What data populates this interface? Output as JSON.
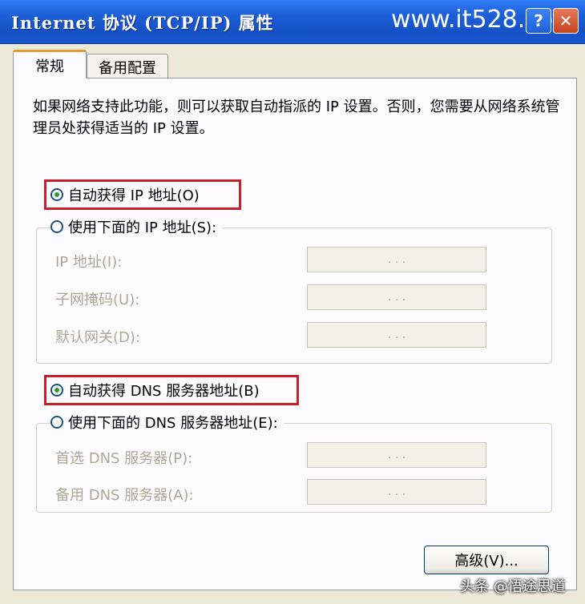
{
  "window": {
    "title": "Internet 协议 (TCP/IP) 属性",
    "watermark": "www.it528.com",
    "help_glyph": "?",
    "close_glyph": "✕"
  },
  "tabs": [
    {
      "label": "常规",
      "active": true
    },
    {
      "label": "备用配置",
      "active": false
    }
  ],
  "description": "如果网络支持此功能，则可以获取自动指派的 IP 设置。否则，您需要从网络系统管理员处获得适当的 IP 设置。",
  "ip_section": {
    "auto_radio": {
      "label": "自动获得 IP 地址(O)",
      "selected": true
    },
    "manual_radio": {
      "label": "使用下面的 IP 地址(S):",
      "selected": false
    },
    "fields": [
      {
        "label": "IP 地址(I):",
        "value": ". . ."
      },
      {
        "label": "子网掩码(U):",
        "value": ". . ."
      },
      {
        "label": "默认网关(D):",
        "value": ". . ."
      }
    ]
  },
  "dns_section": {
    "auto_radio": {
      "label": "自动获得 DNS 服务器地址(B)",
      "selected": true
    },
    "manual_radio": {
      "label": "使用下面的 DNS 服务器地址(E):",
      "selected": false
    },
    "fields": [
      {
        "label": "首选 DNS 服务器(P):",
        "value": ". . ."
      },
      {
        "label": "备用 DNS 服务器(A):",
        "value": ". . ."
      }
    ]
  },
  "advanced_button": "高级(V)...",
  "footer_watermark": "头条 @悟途思道",
  "colors": {
    "highlight": "#c8202a",
    "titlebar": "#1d5fd8",
    "radio_dot": "#2a9a2a"
  }
}
